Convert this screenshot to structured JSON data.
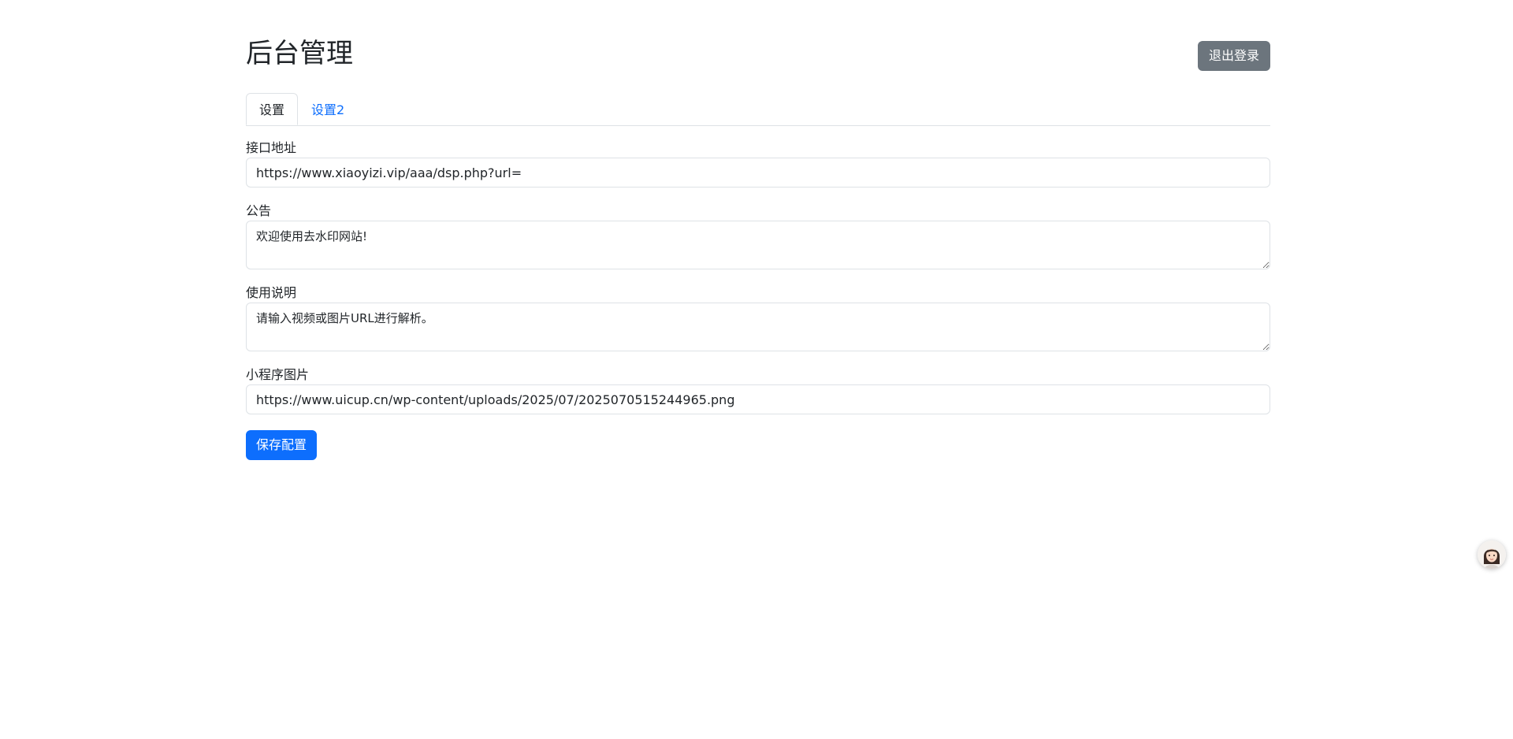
{
  "header": {
    "title": "后台管理",
    "logout_label": "退出登录"
  },
  "tabs": [
    {
      "label": "设置",
      "active": true
    },
    {
      "label": "设置2",
      "active": false
    }
  ],
  "form": {
    "api_url": {
      "label": "接口地址",
      "value": "https://www.xiaoyizi.vip/aaa/dsp.php?url="
    },
    "notice": {
      "label": "公告",
      "value": "欢迎使用去水印网站!"
    },
    "instructions": {
      "label": "使用说明",
      "value": "请输入视频或图片URL进行解析。"
    },
    "mini_program_image": {
      "label": "小程序图片",
      "value": "https://www.uicup.cn/wp-content/uploads/2025/07/2025070515244965.png"
    },
    "save_label": "保存配置"
  },
  "colors": {
    "primary": "#0d6efd",
    "secondary": "#6c757d",
    "border": "#dee2e6"
  },
  "icons": {
    "floating_avatar": "assistant-avatar-icon"
  }
}
